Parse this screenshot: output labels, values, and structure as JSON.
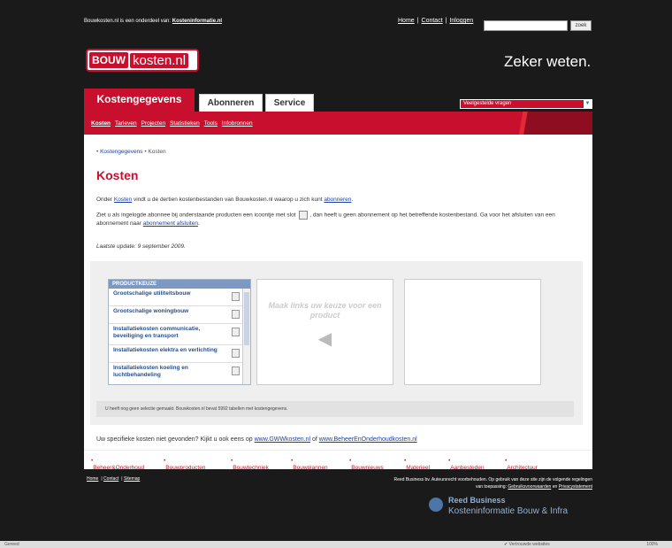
{
  "top": {
    "affiliation": "Bouwkosten.nl is een onderdeel van:",
    "affiliation_link": "Kosteninformatie.nl",
    "links": [
      "Home",
      "Contact",
      "Inloggen"
    ],
    "search_button": "zoek"
  },
  "logo": {
    "part1": "BOUW",
    "part2": "kosten.nl"
  },
  "tagline": "Zeker weten.",
  "tabs": [
    "Kostengegevens",
    "Abonneren",
    "Service"
  ],
  "faq_select": "Veelgestelde vragen",
  "subnav": [
    "Kosten",
    "Tarieven",
    "Projecten",
    "Statistieken",
    "Tools",
    "Infobronnen"
  ],
  "breadcrumb": {
    "item1": "Kostengegevens",
    "item2": "Kosten"
  },
  "page_title": "Kosten",
  "intro": {
    "p1_pre": "Onder",
    "p1_link": "Kosten",
    "p1_mid": "vindt u de dertien kostenbestanden van Bouwkosten.nl waarop u zich kunt",
    "p1_link2": "abonneren",
    "p1_end": ".",
    "p2_pre": "Ziet u als ingelogde abonnee bij onderstaande producten een icoontje met slot",
    "p2_mid": ", dan heeft u geen abonnement op het betreffende kostenbestand. Ga voor het afsluiten van een abonnement naar",
    "p2_link": "abonnement afsluiten",
    "p2_end": ".",
    "update": "Laatste update: 9 september 2009."
  },
  "product_choice": {
    "header": "PRODUCTKEUZE",
    "items": [
      "Grootschalige utiliteitsbouw",
      "Grootschalige woningbouw",
      "Installatiekosten communicatie, beveiliging en transport",
      "Installatiekosten elektra en verlichting",
      "Installatiekosten koeling en luchtbehandeling"
    ],
    "item3_display": "Installatiekosten communicatie, beveiliging en transport",
    "prompt": "Maak links uw keuze voor een product"
  },
  "notice": "U heeft nog geen selectie gemaakt. Bouwkosten.nl bevat 5992 tabellen met kostengegevens.",
  "specifiek": {
    "text": "Uw specifieke kosten niet gevonden? Kijkt u ook eens op",
    "link1": "www.GWWkosten.nl",
    "of": "of",
    "link2": "www.BeheerEnOnderhoudkosten.nl"
  },
  "bottom_links": [
    "Beheer&Onderhoud",
    "Bouwproducten",
    "Bouwtechniek",
    "Bouwplannen",
    "Bouwnieuws",
    "Materieel",
    "Aanbesteden",
    "Architectuur"
  ],
  "footer": {
    "links": [
      "Home",
      "Contact",
      "Sitemap"
    ],
    "legal1": "Reed Business bv. Auteursrecht voorbehouden. Op gebruik van deze site zijn de volgende regelingen",
    "legal2_pre": "van toepassing:",
    "legal2_link1": "Gebruiksvoorwaarden",
    "legal2_en": "en",
    "legal2_link2": "Privacystatement",
    "reed1": "Reed Business",
    "reed2": "Kosteninformatie Bouw & Infra"
  },
  "statusbar": {
    "left": "Gereed",
    "mid": "Vertrouwde websites",
    "zoom": "100%"
  }
}
